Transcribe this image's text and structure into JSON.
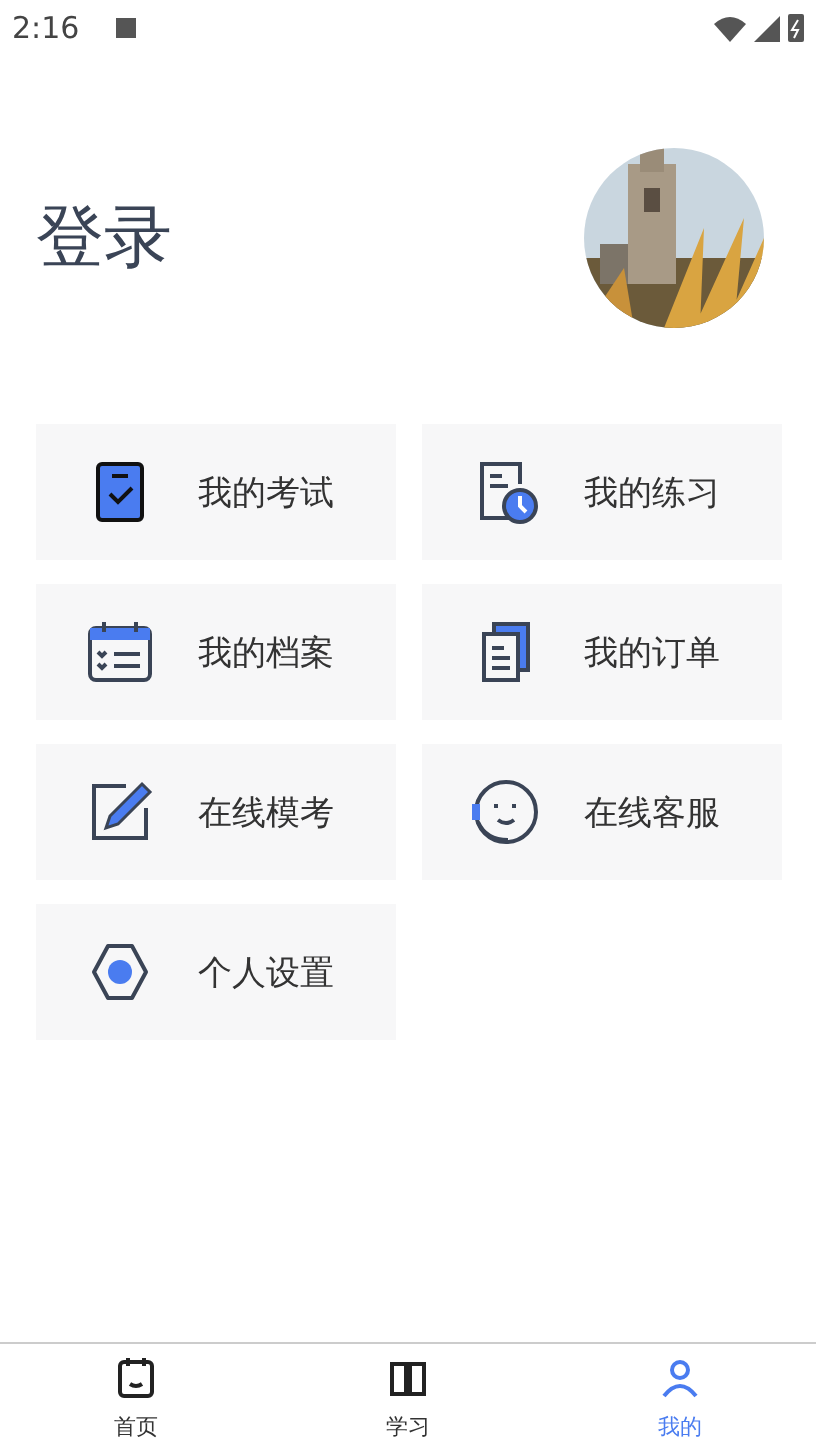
{
  "status_bar": {
    "time": "2:16"
  },
  "header": {
    "title": "登录"
  },
  "menu": [
    {
      "kind": "exam",
      "label": "我的考试"
    },
    {
      "kind": "practice",
      "label": "我的练习"
    },
    {
      "kind": "archive",
      "label": "我的档案"
    },
    {
      "kind": "order",
      "label": "我的订单"
    },
    {
      "kind": "mock",
      "label": "在线模考"
    },
    {
      "kind": "service",
      "label": "在线客服"
    },
    {
      "kind": "settings",
      "label": "个人设置"
    }
  ],
  "bottom_nav": [
    {
      "kind": "home",
      "label": "首页",
      "selected": false
    },
    {
      "kind": "study",
      "label": "学习",
      "selected": false
    },
    {
      "kind": "mine",
      "label": "我的",
      "selected": true
    }
  ]
}
